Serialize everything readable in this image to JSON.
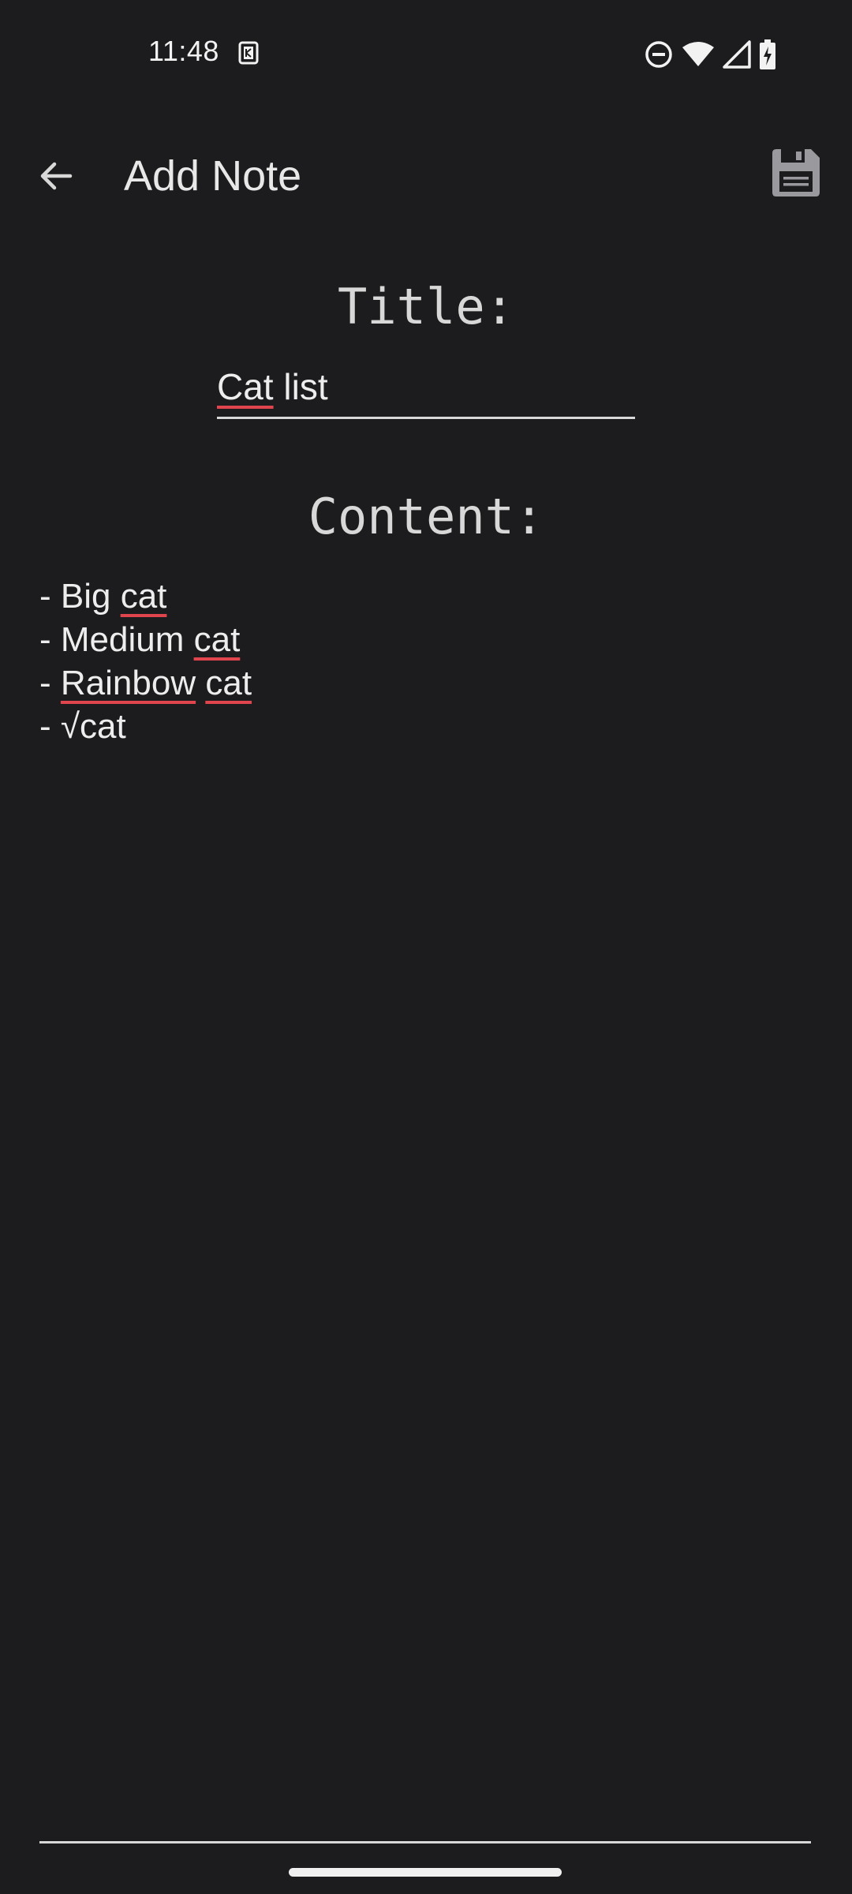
{
  "status_bar": {
    "time": "11:48",
    "notification_icon": "keyboard-icon",
    "icons": [
      "do-not-disturb-icon",
      "wifi-icon",
      "signal-icon",
      "battery-charging-icon"
    ]
  },
  "app_bar": {
    "back_icon": "arrow-back-icon",
    "title": "Add Note",
    "save_icon": "floppy-save-icon"
  },
  "form": {
    "title_label": "Title:",
    "title_value_parts": [
      {
        "text": "Cat",
        "misspelled": true
      },
      {
        "text": " list",
        "misspelled": false
      }
    ],
    "content_label": "Content:",
    "content_lines": [
      [
        {
          "text": "- Big ",
          "misspelled": false
        },
        {
          "text": "cat",
          "misspelled": true
        }
      ],
      [
        {
          "text": "- Medium ",
          "misspelled": false
        },
        {
          "text": "cat",
          "misspelled": true
        }
      ],
      [
        {
          "text": "- ",
          "misspelled": false
        },
        {
          "text": "Rainbow",
          "misspelled": true
        },
        {
          "text": " ",
          "misspelled": false
        },
        {
          "text": "cat",
          "misspelled": true
        }
      ],
      [
        {
          "text": "- √cat",
          "misspelled": false
        }
      ]
    ]
  },
  "colors": {
    "background": "#1c1c1e",
    "text": "#ededed",
    "spellcheck_underline": "#e0444c"
  }
}
